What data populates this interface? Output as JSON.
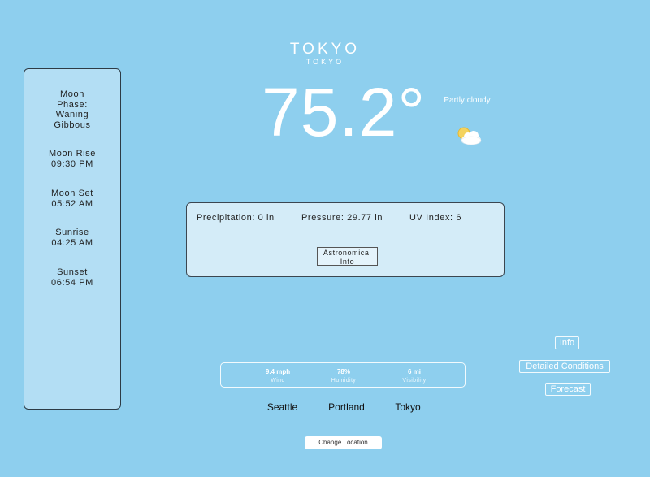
{
  "header": {
    "city": "TOKYO",
    "region": "TOKYO"
  },
  "current": {
    "temperature": "75.2°",
    "condition": "Partly cloudy",
    "condition_icon": "partly-cloudy-icon"
  },
  "astronomy": [
    {
      "label": "Moon Phase: Waning Gibbous",
      "lines": [
        "Moon",
        "Phase:",
        "Waning",
        "Gibbous"
      ]
    },
    {
      "label": "Moon Rise",
      "value": "09:30 PM"
    },
    {
      "label": "Moon Set",
      "value": "05:52 AM"
    },
    {
      "label": "Sunrise",
      "value": "04:25 AM"
    },
    {
      "label": "Sunset",
      "value": "06:54 PM"
    }
  ],
  "details": {
    "precipitation": "Precipitation: 0 in",
    "pressure": "Pressure: 29.77 in",
    "uv_index": "UV Index: 6",
    "astro_button": [
      "Astronomical",
      "Info"
    ]
  },
  "stats": [
    {
      "value": "9.4 mph",
      "label": "Wind"
    },
    {
      "value": "78%",
      "label": "Humidity"
    },
    {
      "value": "6 mi",
      "label": "Visibility"
    }
  ],
  "side_buttons": {
    "info": "Info",
    "detailed": "Detailed Conditions",
    "forecast": "Forecast"
  },
  "cities": [
    "Seattle",
    "Portland",
    "Tokyo"
  ],
  "change_location": "Change Location"
}
